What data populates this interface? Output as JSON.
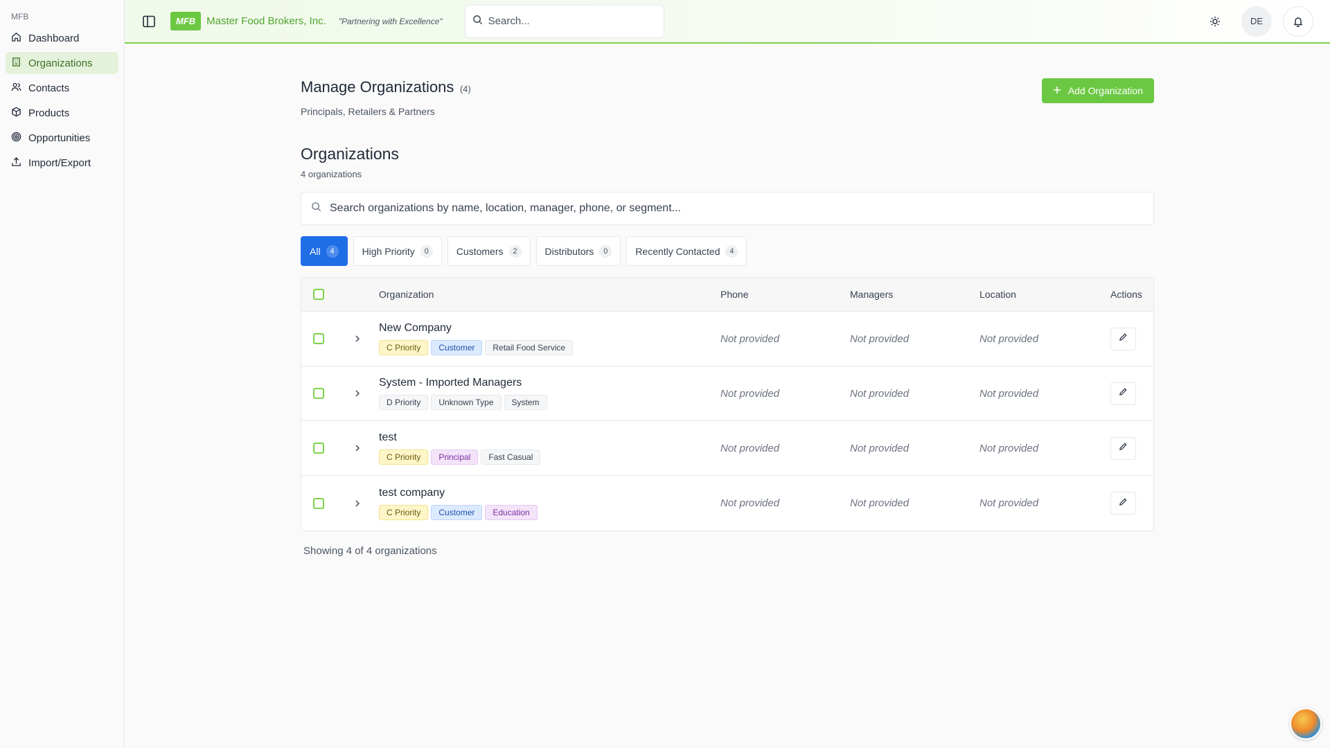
{
  "sidebar": {
    "brand": "MFB",
    "items": [
      {
        "label": "Dashboard",
        "icon": "home-icon"
      },
      {
        "label": "Organizations",
        "icon": "building-icon",
        "active": true
      },
      {
        "label": "Contacts",
        "icon": "users-icon"
      },
      {
        "label": "Products",
        "icon": "package-icon"
      },
      {
        "label": "Opportunities",
        "icon": "target-icon"
      },
      {
        "label": "Import/Export",
        "icon": "upload-icon"
      }
    ]
  },
  "header": {
    "logo": "MFB",
    "company": "Master Food Brokers, Inc.",
    "tagline": "\"Partnering with Excellence\"",
    "search_placeholder": "Search...",
    "avatar_initials": "DE"
  },
  "page": {
    "title": "Manage Organizations",
    "count": "(4)",
    "subtitle": "Principals, Retailers & Partners",
    "add_button": "Add Organization"
  },
  "section": {
    "title": "Organizations",
    "count": "4 organizations",
    "search_placeholder": "Search organizations by name, location, manager, phone, or segment..."
  },
  "tabs": [
    {
      "label": "All",
      "count": "4",
      "active": true
    },
    {
      "label": "High Priority",
      "count": "0"
    },
    {
      "label": "Customers",
      "count": "2"
    },
    {
      "label": "Distributors",
      "count": "0"
    },
    {
      "label": "Recently Contacted",
      "count": "4"
    }
  ],
  "table": {
    "headers": {
      "organization": "Organization",
      "phone": "Phone",
      "managers": "Managers",
      "location": "Location",
      "actions": "Actions"
    },
    "rows": [
      {
        "name": "New Company",
        "tags": [
          "C Priority",
          "Customer",
          "Retail Food Service"
        ],
        "phone": "Not provided",
        "managers": "Not provided",
        "location": "Not provided"
      },
      {
        "name": "System - Imported Managers",
        "tags": [
          "D Priority",
          "Unknown Type",
          "System"
        ],
        "phone": "Not provided",
        "managers": "Not provided",
        "location": "Not provided"
      },
      {
        "name": "test",
        "tags": [
          "C Priority",
          "Principal",
          "Fast Casual"
        ],
        "phone": "Not provided",
        "managers": "Not provided",
        "location": "Not provided"
      },
      {
        "name": "test company",
        "tags": [
          "C Priority",
          "Customer",
          "Education"
        ],
        "phone": "Not provided",
        "managers": "Not provided",
        "location": "Not provided"
      }
    ]
  },
  "footer": "Showing 4 of 4 organizations",
  "colors": {
    "brand": "#6cc843",
    "accent": "#1f6ee6"
  }
}
